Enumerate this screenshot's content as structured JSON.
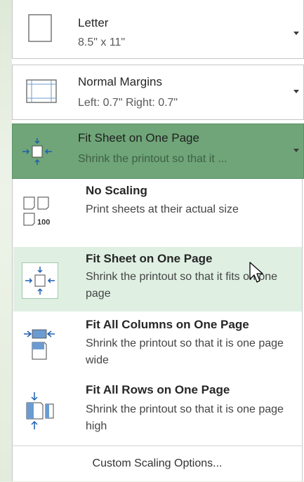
{
  "paper_size": {
    "title": "Letter",
    "subtitle": "8.5\" x 11\"",
    "icon": "paper-icon"
  },
  "margins": {
    "title": "Normal Margins",
    "subtitle": "Left:  0.7\"    Right:  0.7\"",
    "icon": "margins-icon"
  },
  "scaling": {
    "title": "Fit Sheet on One Page",
    "subtitle": "Shrink the printout so that it ...",
    "icon": "fit-sheet-icon",
    "accent": "#6fa578"
  },
  "scaling_menu": {
    "items": [
      {
        "title": "No Scaling",
        "description": "Print sheets at their actual size",
        "icon": "no-scaling-icon",
        "selected": false
      },
      {
        "title": "Fit Sheet on One Page",
        "description": "Shrink the printout so that it fits on one page",
        "icon": "fit-sheet-icon",
        "selected": true
      },
      {
        "title": "Fit All Columns on One Page",
        "description": "Shrink the printout so that it is one page wide",
        "icon": "fit-columns-icon",
        "selected": false
      },
      {
        "title": "Fit All Rows on One Page",
        "description": "Shrink the printout so that it is one page high",
        "icon": "fit-rows-icon",
        "selected": false
      }
    ],
    "no_scaling_badge": "100",
    "custom_label": "Custom Scaling Options...",
    "selected_bg": "#dff0e3"
  }
}
